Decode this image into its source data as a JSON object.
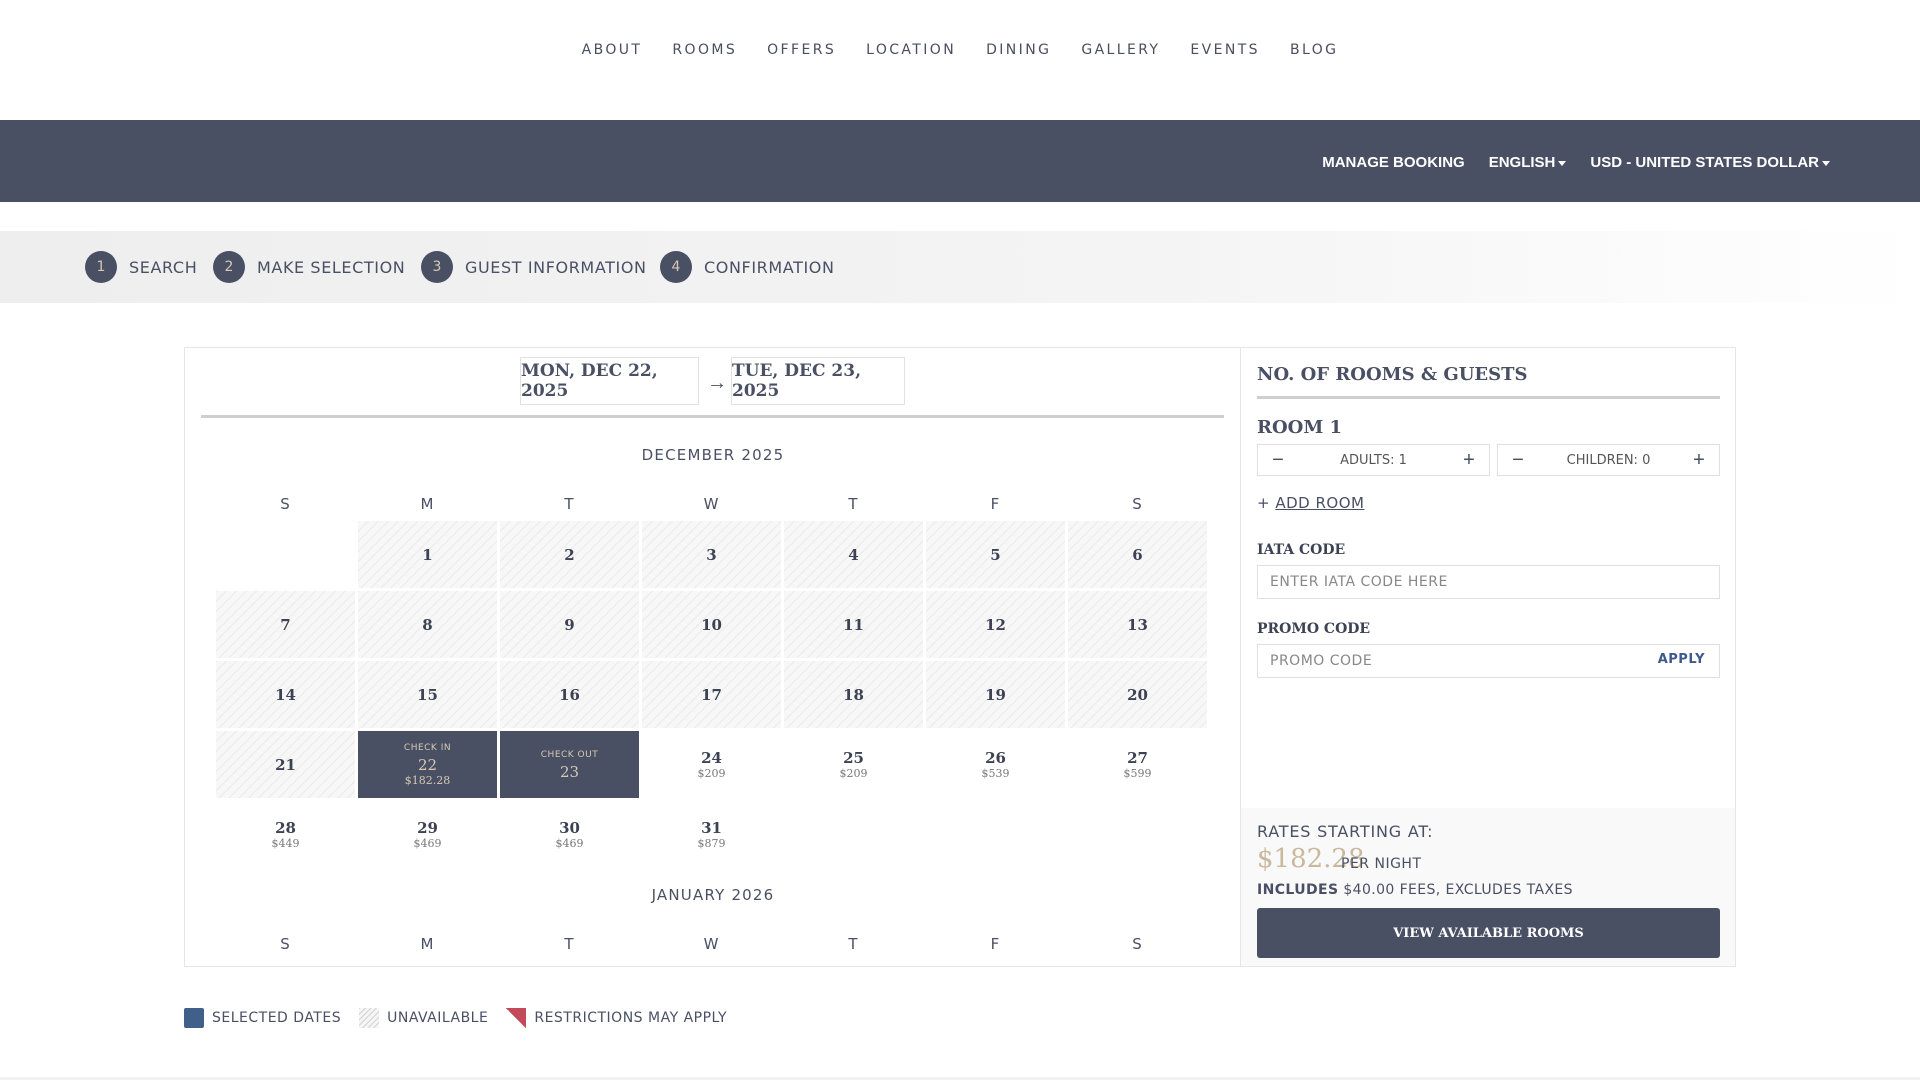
{
  "topnav": [
    "ABOUT",
    "ROOMS",
    "OFFERS",
    "LOCATION",
    "DINING",
    "GALLERY",
    "EVENTS",
    "BLOG"
  ],
  "header": {
    "manage_booking": "MANAGE BOOKING",
    "language": "ENGLISH",
    "currency": "USD - UNITED STATES DOLLAR"
  },
  "steps": [
    {
      "num": "1",
      "label": "SEARCH"
    },
    {
      "num": "2",
      "label": "MAKE SELECTION"
    },
    {
      "num": "3",
      "label": "GUEST INFORMATION"
    },
    {
      "num": "4",
      "label": "CONFIRMATION"
    }
  ],
  "dates": {
    "checkin": "MON, DEC 22, 2025",
    "arrow": "→",
    "checkout": "TUE, DEC 23, 2025"
  },
  "calendar": {
    "weekdays": [
      "S",
      "M",
      "T",
      "W",
      "T",
      "F",
      "S"
    ],
    "months": [
      {
        "title": "DECEMBER 2025",
        "weeks": [
          [
            null,
            {
              "day": "1",
              "unavailable": true
            },
            {
              "day": "2",
              "unavailable": true
            },
            {
              "day": "3",
              "unavailable": true
            },
            {
              "day": "4",
              "unavailable": true
            },
            {
              "day": "5",
              "unavailable": true
            },
            {
              "day": "6",
              "unavailable": true
            }
          ],
          [
            {
              "day": "7",
              "unavailable": true
            },
            {
              "day": "8",
              "unavailable": true
            },
            {
              "day": "9",
              "unavailable": true
            },
            {
              "day": "10",
              "unavailable": true
            },
            {
              "day": "11",
              "unavailable": true
            },
            {
              "day": "12",
              "unavailable": true
            },
            {
              "day": "13",
              "unavailable": true
            }
          ],
          [
            {
              "day": "14",
              "unavailable": true
            },
            {
              "day": "15",
              "unavailable": true
            },
            {
              "day": "16",
              "unavailable": true
            },
            {
              "day": "17",
              "unavailable": true
            },
            {
              "day": "18",
              "unavailable": true
            },
            {
              "day": "19",
              "unavailable": true
            },
            {
              "day": "20",
              "unavailable": true
            }
          ],
          [
            {
              "day": "21",
              "unavailable": true
            },
            {
              "day": "22",
              "price": "$182.28",
              "selected": true,
              "tag": "CHECK IN"
            },
            {
              "day": "23",
              "selected": true,
              "tag": "CHECK OUT"
            },
            {
              "day": "24",
              "price": "$209"
            },
            {
              "day": "25",
              "price": "$209"
            },
            {
              "day": "26",
              "price": "$539"
            },
            {
              "day": "27",
              "price": "$599"
            }
          ],
          [
            {
              "day": "28",
              "price": "$449"
            },
            {
              "day": "29",
              "price": "$469"
            },
            {
              "day": "30",
              "price": "$469"
            },
            {
              "day": "31",
              "price": "$879"
            },
            null,
            null,
            null
          ]
        ]
      },
      {
        "title": "JANUARY 2026",
        "weeks": []
      }
    ]
  },
  "guests": {
    "title": "NO. OF ROOMS & GUESTS",
    "room_title": "ROOM 1",
    "adults": "ADULTS: 1",
    "children": "CHILDREN: 0",
    "minus": "−",
    "plus": "+",
    "add_room_icon": "+",
    "add_room": "ADD ROOM",
    "iata_label": "IATA CODE",
    "iata_placeholder": "ENTER IATA CODE HERE",
    "promo_label": "PROMO CODE",
    "promo_placeholder": "PROMO CODE",
    "apply": "APPLY"
  },
  "rates": {
    "label": "RATES STARTING AT:",
    "price": "$182.28",
    "per": "PER NIGHT",
    "includes_bold": "INCLUDES",
    "includes_rest": "$40.00 FEES, EXCLUDES TAXES",
    "button": "VIEW AVAILABLE ROOMS"
  },
  "legend": {
    "selected": "SELECTED DATES",
    "unavailable": "UNAVAILABLE",
    "restrictions": "RESTRICTIONS MAY APPLY"
  },
  "colors": {
    "brand_dark": "#4a5064",
    "gold": "#c9b89c",
    "legend_selected": "#40608a",
    "restriction": "#c24a5a"
  }
}
